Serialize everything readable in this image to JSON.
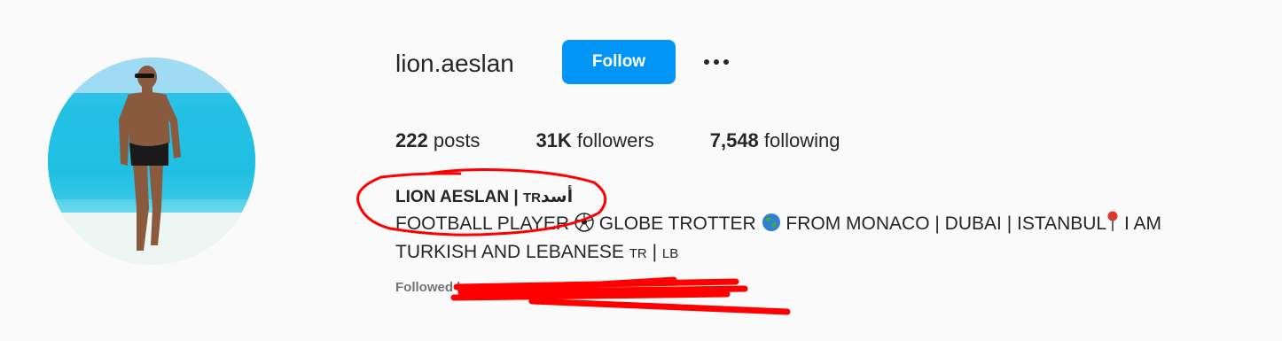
{
  "profile": {
    "username": "lion.aeslan",
    "follow_label": "Follow",
    "more_label": "•••",
    "stats": {
      "posts_count": "222",
      "posts_label": "posts",
      "followers_count": "31K",
      "followers_label": "followers",
      "following_count": "7,548",
      "following_label": "following"
    },
    "full_name": "LION AESLAN | ",
    "full_name_tag": "TR",
    "full_name_arabic": "أسد",
    "bio": {
      "part1": "FOOTBALL PLAYER ",
      "part2": " GLOBE TROTTER ",
      "part3": " FROM MONACO | DUBAI | ISTANBUL",
      "part4": " I AM TURKISH AND LEBANESE ",
      "flag_tr": "TR",
      "separator": " | ",
      "flag_lb": "LB"
    },
    "followed_by_prefix": "Followed by"
  },
  "colors": {
    "follow_button": "#0095f6",
    "annotation": "#ff0000",
    "text": "#262626",
    "muted": "#737373"
  },
  "icons": [
    "soccer-ball-icon",
    "globe-icon",
    "pin-icon",
    "more-dots-icon"
  ]
}
